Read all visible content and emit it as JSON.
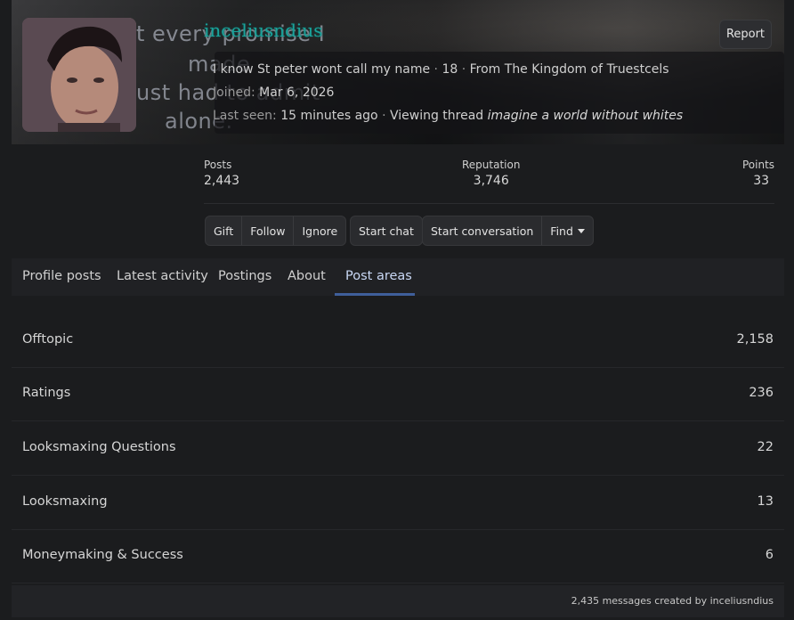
{
  "profile": {
    "username": "inceliusndius",
    "tagline": "I know St peter wont call my name",
    "age": "18",
    "location": "From The Kingdom of Truestcels",
    "joined_label": "Joined:",
    "joined_date": "Mar 6, 2026",
    "last_seen_label": "Last seen:",
    "last_seen": "15 minutes ago",
    "activity": "Viewing thread",
    "activity_thread": "imagine a world without whites",
    "report_label": "Report",
    "separator": "·"
  },
  "banner_words": [
    "t every promise I",
    "made",
    "ust had to admit",
    "alone."
  ],
  "stats": [
    {
      "label": "Posts",
      "value": "2,443"
    },
    {
      "label": "Reputation",
      "value": "3,746"
    },
    {
      "label": "Points",
      "value": "33"
    }
  ],
  "actions": {
    "gift": "Gift",
    "follow": "Follow",
    "ignore": "Ignore",
    "start_chat": "Start chat",
    "start_conversation": "Start conversation",
    "find": "Find"
  },
  "tabs": [
    {
      "label": "Profile posts"
    },
    {
      "label": "Latest activity"
    },
    {
      "label": "Postings"
    },
    {
      "label": "About"
    },
    {
      "label": "Post areas"
    }
  ],
  "post_areas": [
    {
      "name": "Offtopic",
      "count": "2,158"
    },
    {
      "name": "Ratings",
      "count": "236"
    },
    {
      "name": "Looksmaxing Questions",
      "count": "22"
    },
    {
      "name": "Looksmaxing",
      "count": "13"
    },
    {
      "name": "Moneymaking & Success",
      "count": "6"
    }
  ],
  "footer_text": "2,435 messages created by inceliusndius",
  "colors": {
    "username": "#1aa39b",
    "active_tab_underline": "#3f5f9b",
    "background": "#1b1c1e"
  }
}
